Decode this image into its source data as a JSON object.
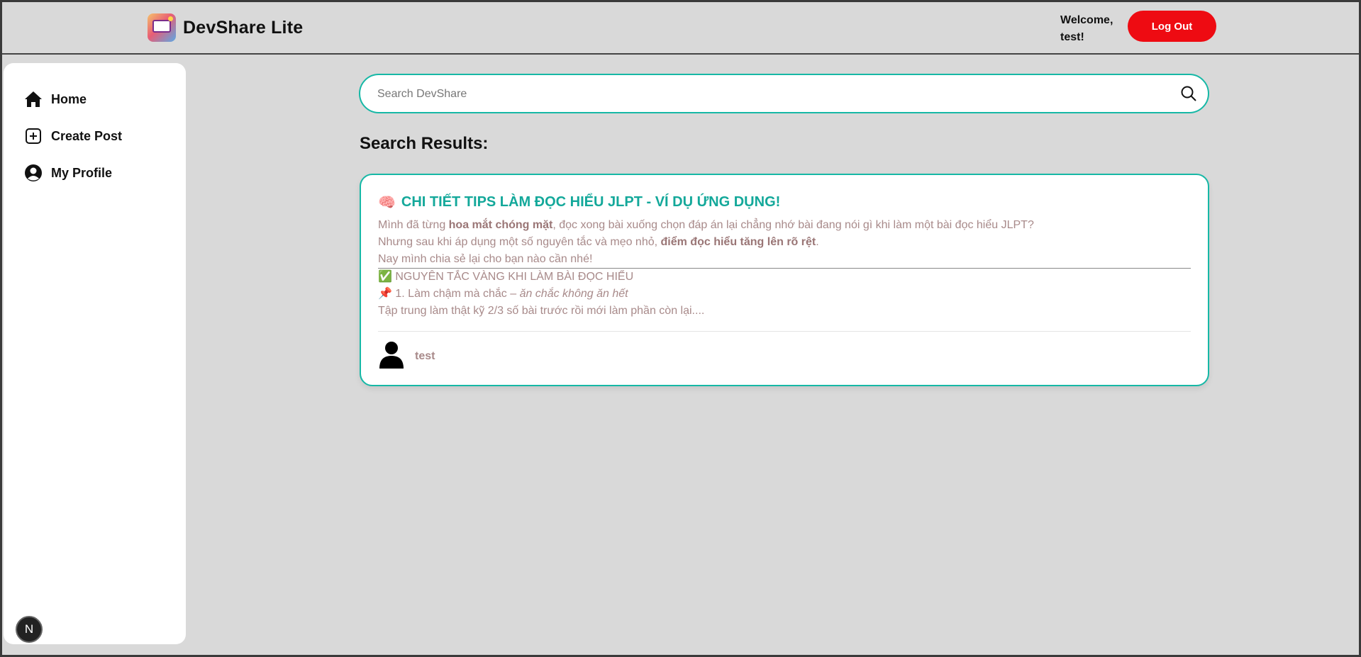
{
  "header": {
    "brand": "DevShare Lite",
    "welcome": "Welcome, test!",
    "logout_label": "Log Out"
  },
  "sidebar": {
    "items": [
      {
        "label": "Home",
        "icon": "home-icon"
      },
      {
        "label": "Create Post",
        "icon": "plus-square-icon"
      },
      {
        "label": "My Profile",
        "icon": "user-circle-icon"
      }
    ],
    "badge": "N"
  },
  "search": {
    "placeholder": "Search DevShare",
    "value": ""
  },
  "results": {
    "title": "Search Results:",
    "posts": [
      {
        "emoji": "🧠",
        "title": "CHI TIẾT TIPS LÀM ĐỌC HIỂU JLPT - VÍ DỤ ỨNG DỤNG!",
        "line1_a": "Mình đã từng ",
        "line1_b": "hoa mắt chóng mặt",
        "line1_c": ", đọc xong bài xuống chọn đáp án lại chẳng nhớ bài đang nói gì khi làm một bài đọc hiểu JLPT?",
        "line2_a": "Nhưng sau khi áp dụng một số nguyên tắc và mẹo nhỏ, ",
        "line2_b": "điểm đọc hiểu tăng lên rõ rệt",
        "line2_c": ".",
        "line3": "Nay mình chia sẻ lại cho bạn nào cần nhé!",
        "line4_emoji": "✅",
        "line4": "NGUYÊN TẮC VÀNG KHI LÀM BÀI ĐỌC HIỂU",
        "line5_emoji": "📌",
        "line5_a": "1. Làm chậm mà chắc – ",
        "line5_b": "ăn chắc không ăn hết",
        "line6": "Tập trung làm thật kỹ 2/3 số bài trước rồi mới làm phần còn lại....",
        "author": "test"
      }
    ]
  },
  "colors": {
    "accent": "#16b8a6",
    "title": "#13a89a",
    "danger": "#ee0b12",
    "background": "#d9d9d9"
  }
}
